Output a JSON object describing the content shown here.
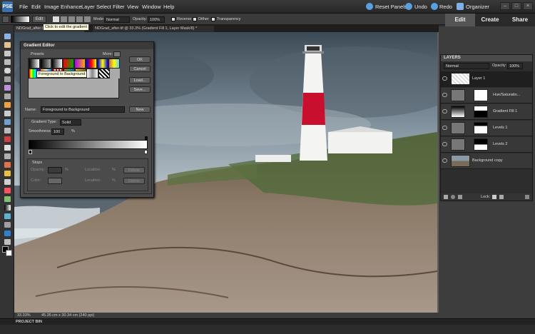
{
  "app": {
    "logo_text": "PSE"
  },
  "menu": [
    "File",
    "Edit",
    "Image",
    "Enhance",
    "Layer",
    "Select",
    "Filter",
    "View",
    "Window",
    "Help"
  ],
  "right_menu": {
    "reset_panels": "Reset Panels",
    "undo": "Undo",
    "redo": "Redo",
    "organizer": "Organizer"
  },
  "mode_tabs": {
    "edit": "Edit",
    "create": "Create",
    "share": "Share"
  },
  "options_bar": {
    "edit_button": "Edit",
    "mode_label": "Mode:",
    "mode_value": "Normal",
    "opacity_label": "Opacity:",
    "opacity_value": "100%",
    "reverse": "Reverse",
    "dither": "Dither",
    "transparency": "Transparency"
  },
  "tooltip_edit": "Click to edit the gradient",
  "doc_tabs": [
    "NDGrad_after.t...",
    "NDGrad_after.tif @ 33.3% (Gradient Fill 1, Layer Mask/8) *"
  ],
  "gradient_editor": {
    "title": "Gradient Editor",
    "presets_label": "Presets",
    "more_label": "More:",
    "preset_tooltip": "Foreground to Background",
    "buttons": [
      "OK",
      "Cancel",
      "Load...",
      "Save..."
    ],
    "name_label": "Name:",
    "name_value": "Foreground to Background",
    "new_button": "New",
    "type_label": "Gradient Type:",
    "type_value": "Solid",
    "smoothness_label": "Smoothness:",
    "smoothness_value": "100",
    "smoothness_unit": "%",
    "stops_label": "Stops",
    "opacity_label": "Opacity:",
    "opacity_unit": "%",
    "location_label": "Location:",
    "location_unit": "%",
    "delete_label": "Delete",
    "color_label": "Color:"
  },
  "status": {
    "zoom": "33.33%",
    "doc_info": "45.35 cm x 30.34 cm (240 ppi)"
  },
  "bin_label": "PROJECT BIN",
  "layers_panel": {
    "title": "LAYERS",
    "blend_mode": "Normal",
    "opacity_label": "Opacity:",
    "opacity_value": "100%",
    "lock_label": "Lock:",
    "layers": [
      {
        "name": "Layer 1",
        "selected": true
      },
      {
        "name": "Hue/Saturatio...",
        "selected": false
      },
      {
        "name": "Gradient Fill 1",
        "selected": false
      },
      {
        "name": "Levels 1",
        "selected": false
      },
      {
        "name": "Levels 2",
        "selected": false
      },
      {
        "name": "Background copy",
        "selected": false
      }
    ]
  },
  "colors": {
    "accent_blue": "#3a6fb0",
    "lighthouse_red": "#c8102e",
    "selected_layer": "#1f1f1f"
  }
}
